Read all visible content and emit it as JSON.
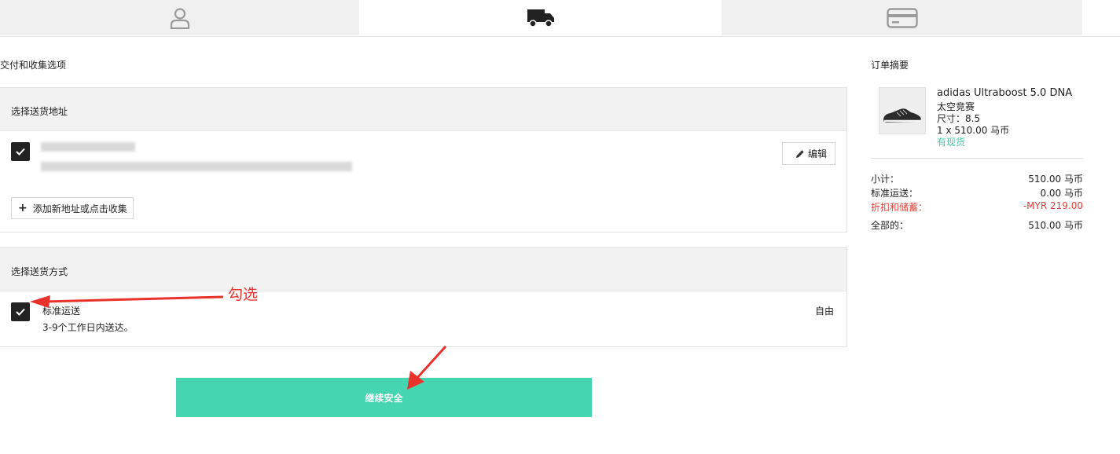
{
  "steps": {
    "items": [
      "account",
      "delivery",
      "payment"
    ],
    "active": "delivery",
    "icons": [
      "user-icon",
      "truck-icon",
      "credit-card-icon"
    ]
  },
  "main": {
    "title": "交付和收集选项",
    "address_section": {
      "heading": "选择送货地址",
      "edit_label": "编辑",
      "add_label": "添加新地址或点击收集"
    },
    "shipping_section": {
      "heading": "选择送货方式",
      "method_name": "标准运送",
      "method_desc": "3-9个工作日内送达。",
      "price": "自由"
    },
    "continue_label": "继续安全"
  },
  "annotation": {
    "label": "勾选"
  },
  "summary": {
    "title": "订单摘要",
    "product": {
      "name": "adidas Ultraboost 5.0 DNA",
      "color": "太空竞赛",
      "size": "尺寸：8.5",
      "qty_price": "1 x  510.00 马币",
      "stock": "有现货"
    },
    "rows": [
      {
        "label": "小计：",
        "value": "510.00 马币"
      },
      {
        "label": "标准运送：",
        "value": "0.00 马币"
      },
      {
        "label": "折扣和储蓄：",
        "value": "-MYR 219.00"
      },
      {
        "label": "全部的：",
        "value": "510.00 马币"
      }
    ]
  },
  "colors": {
    "accent": "#45d5b0",
    "discount": "#e1403a",
    "stock": "#45c9a4",
    "annotation": "#e8322b"
  }
}
